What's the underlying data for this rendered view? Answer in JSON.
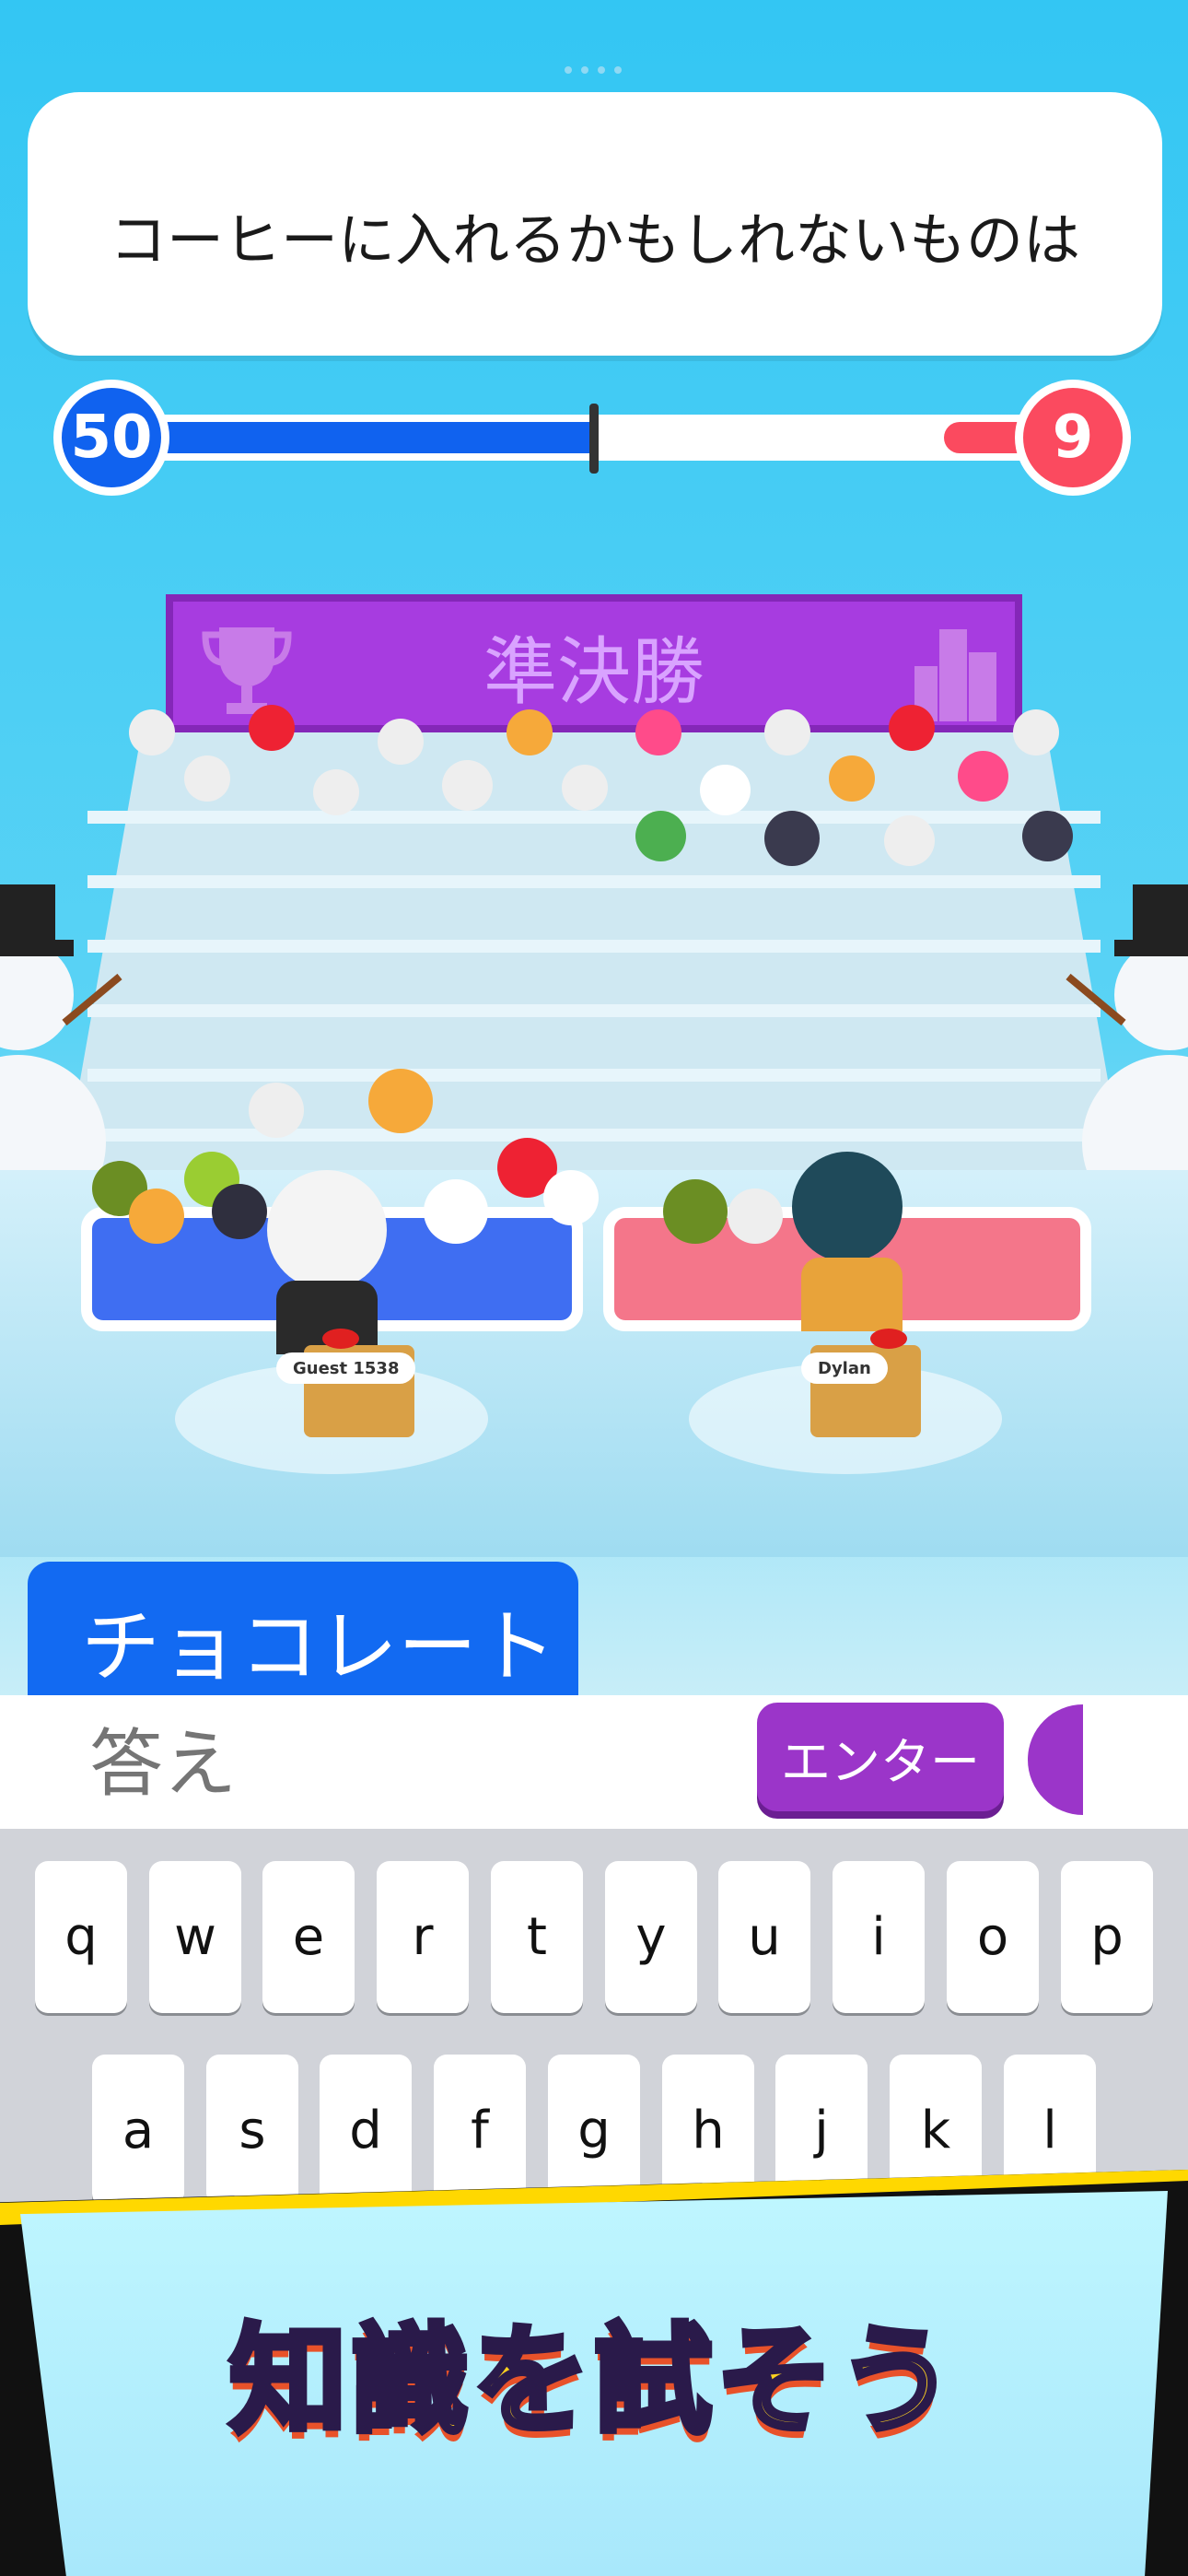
{
  "question": {
    "text": "コーヒーに入れるかもしれないものは"
  },
  "scores": {
    "left": "50",
    "right": "9",
    "progress_fraction": 0.5
  },
  "round": {
    "title": "準決勝"
  },
  "players": [
    {
      "name": "Guest 1538",
      "team": "blue"
    },
    {
      "name": "Dylan",
      "team": "red"
    }
  ],
  "answer_tab": {
    "label": "チョコレート"
  },
  "input": {
    "placeholder": "答え"
  },
  "enter_button": {
    "label": "エンター"
  },
  "keyboard": {
    "row1": [
      "q",
      "w",
      "e",
      "r",
      "t",
      "y",
      "u",
      "i",
      "o",
      "p"
    ],
    "row2": [
      "a",
      "s",
      "d",
      "f",
      "g",
      "h",
      "j",
      "k",
      "l"
    ]
  },
  "promo": {
    "text": "知識を試そう"
  },
  "colors": {
    "blue": "#1062ef",
    "red": "#fb4a5f",
    "purple": "#9b35c9",
    "sky": "#3cc9f2"
  },
  "icons": [
    "trophy-icon",
    "city-icon",
    "snowman-icon"
  ]
}
